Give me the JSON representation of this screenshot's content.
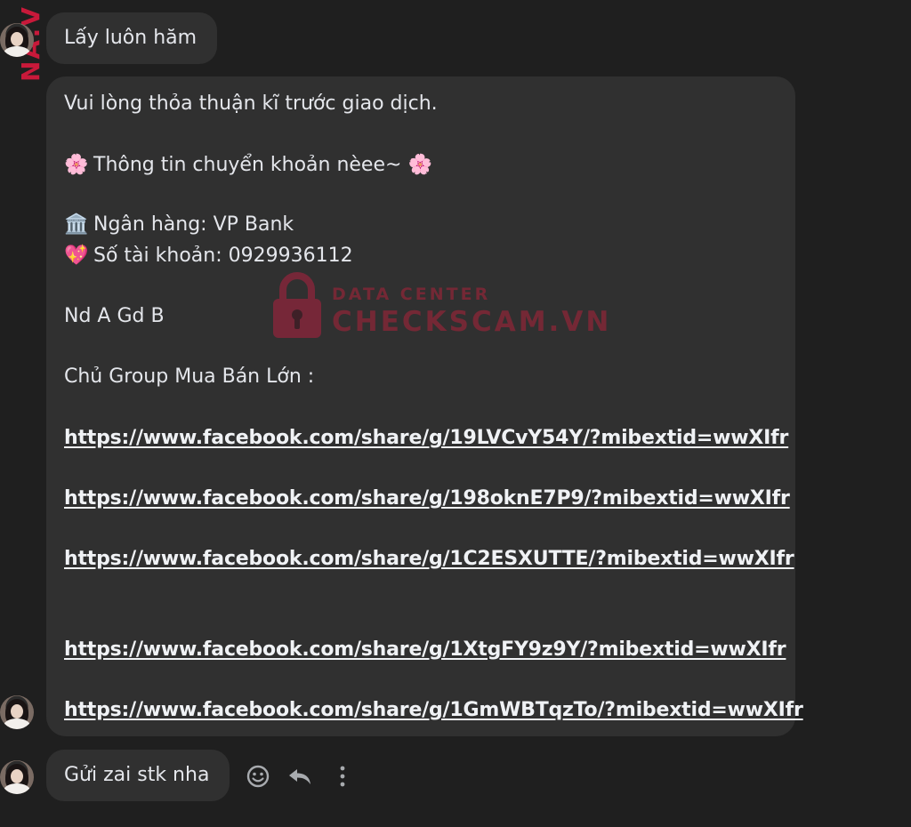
{
  "watermark": {
    "side_text": "NA.V",
    "line1": "DATA CENTER",
    "line2": "CHECKSCAM.VN",
    "color": "#c8193a"
  },
  "messages": {
    "first": "Lấy luôn hăm",
    "main": {
      "line1": "Vui lòng  thỏa thuận kĩ trước giao dịch.",
      "transfer_title": "Thông tin chuyển khoản nèee~",
      "bank": "Ngân hàng: VP Bank",
      "account": "Số tài khoản: 0929936112",
      "content": "Nd A Gd B",
      "group_title": "Chủ Group Mua Bán Lớn :",
      "links": [
        "https://www.facebook.com/share/g/19LVCvY54Y/?mibextid=wwXIfr",
        "https://www.facebook.com/share/g/198oknE7P9/?mibextid=wwXIfr",
        "https://www.facebook.com/share/g/1C2ESXUTTE/?mibextid=wwXIfr",
        "https://www.facebook.com/share/g/1XtgFY9z9Y/?mibextid=wwXIfr",
        "https://www.facebook.com/share/g/1GmWBTqzTo/?mibextid=wwXIfr"
      ]
    },
    "last": "Gửi zai stk nha"
  },
  "icons": {
    "flower": "cherry-blossom-icon",
    "bank": "bank-icon",
    "heart": "sparkling-heart-icon",
    "react": "smiley-icon",
    "reply": "reply-icon",
    "more": "more-vertical-icon"
  },
  "colors": {
    "background": "#1f1f1f",
    "bubble": "#303030",
    "text": "#e4e6eb"
  }
}
